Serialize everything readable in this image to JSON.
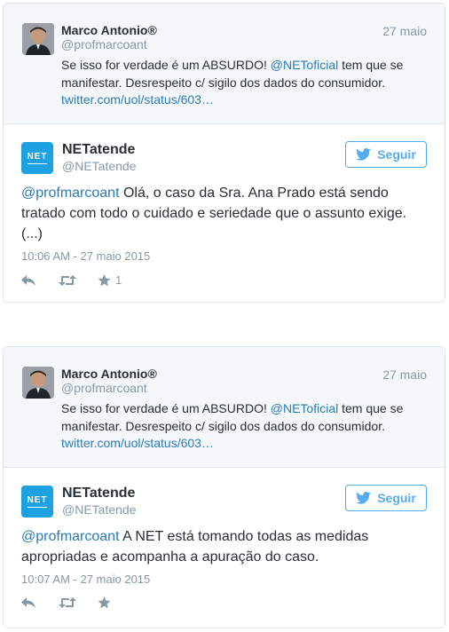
{
  "cards": [
    {
      "quoted": {
        "name": "Marco Antonio®",
        "handle": "@profmarcoant",
        "date": "27 maio",
        "text_before": "Se isso for verdade é um ABSURDO! ",
        "mention": "@NEToficial",
        "text_after": " tem que se manifestar. Desrespeito c/ sigilo dos dados do consumidor. ",
        "link": "twitter.com/uol/status/603…"
      },
      "reply": {
        "name": "NETatende",
        "handle": "@NETatende",
        "follow_label": "Seguir",
        "mention": "@profmarcoant",
        "text": " Olá, o caso da Sra. Ana Prado está sendo tratado com todo o cuidado e seriedade que o assunto exige. (...)",
        "timestamp": "10:06 AM - 27 maio 2015",
        "favorites": "1"
      }
    },
    {
      "quoted": {
        "name": "Marco Antonio®",
        "handle": "@profmarcoant",
        "date": "27 maio",
        "text_before": "Se isso for verdade é um ABSURDO! ",
        "mention": "@NEToficial",
        "text_after": " tem que se manifestar. Desrespeito c/ sigilo dos dados do consumidor. ",
        "link": "twitter.com/uol/status/603…"
      },
      "reply": {
        "name": "NETatende",
        "handle": "@NETatende",
        "follow_label": "Seguir",
        "mention": "@profmarcoant",
        "text": " A NET está tomando todas as medidas apropriadas e acompanha a apuração do caso.",
        "timestamp": "10:07 AM - 27 maio 2015",
        "favorites": ""
      }
    }
  ],
  "logo_text": "NET",
  "icons": {
    "reply": "reply-icon",
    "retweet": "retweet-icon",
    "favorite": "star-icon",
    "follow": "twitter-bird-icon"
  },
  "colors": {
    "link": "#2b7bb9",
    "accent": "#55acee",
    "muted": "#8899a6",
    "net_blue": "#1da1e0"
  }
}
